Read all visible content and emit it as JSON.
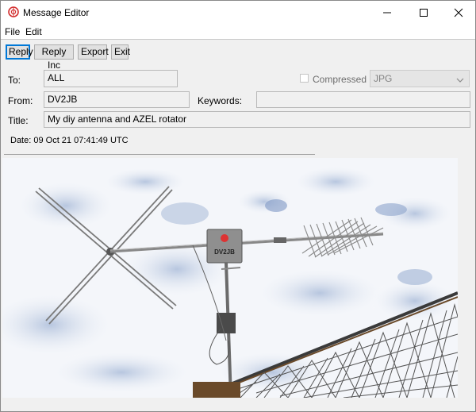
{
  "window": {
    "title": "Message Editor"
  },
  "menu": {
    "file": "File",
    "edit": "Edit"
  },
  "toolbar": {
    "reply": "Reply",
    "reply_inc": "Reply Inc",
    "export": "Export",
    "exit": "Exit"
  },
  "form": {
    "to_label": "To:",
    "to_value": "ALL",
    "compressed_label": "Compressed",
    "compressed_checked": false,
    "format_value": "JPG",
    "from_label": "From:",
    "from_value": "DV2JB",
    "keywords_label": "Keywords:",
    "keywords_value": "",
    "title_label": "Title:",
    "title_value": "My diy antenna and AZEL rotator",
    "date_text": "Date: 09 Oct 21 07:41:49 UTC"
  },
  "image": {
    "box_label": "DV2JB"
  },
  "colors": {
    "accent": "#0078d7",
    "sky": "#c9d6ea",
    "app_icon": "#d32f2f"
  }
}
